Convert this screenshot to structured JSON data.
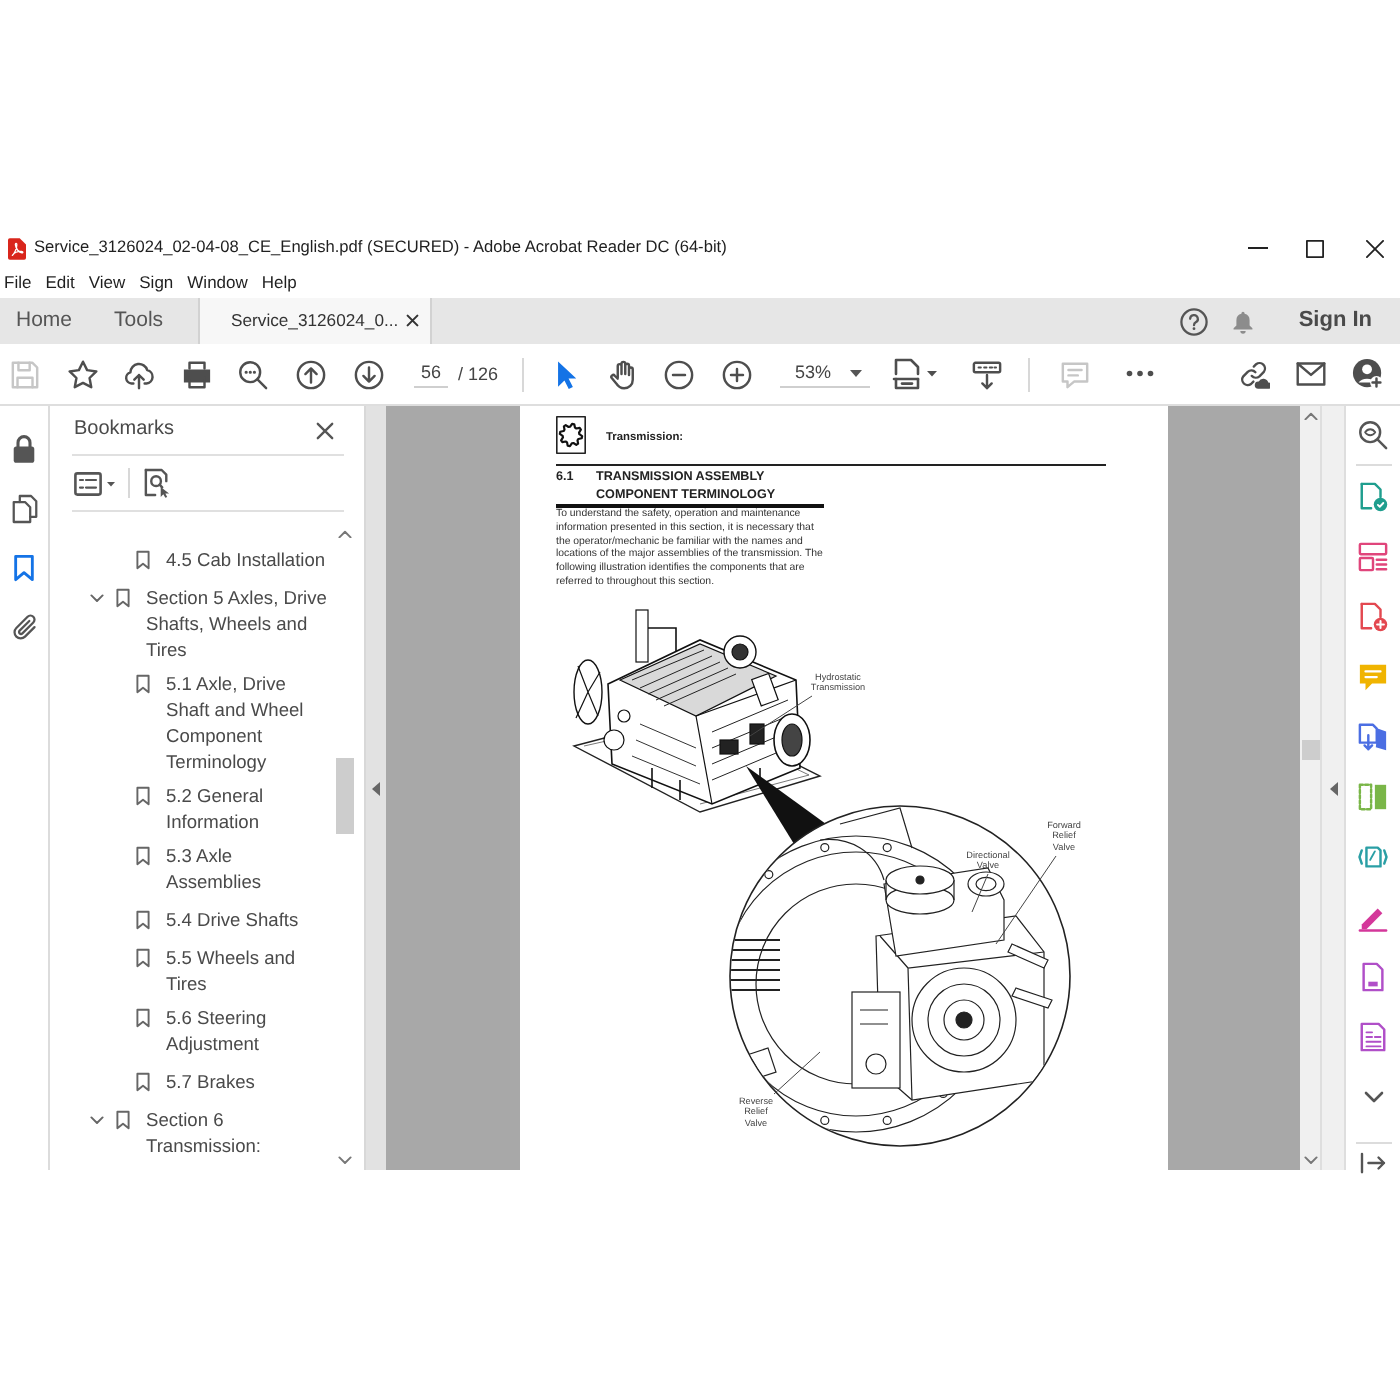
{
  "window": {
    "title": "Service_3126024_02-04-08_CE_English.pdf (SECURED) - Adobe Acrobat Reader DC (64-bit)"
  },
  "menu_bar": [
    "File",
    "Edit",
    "View",
    "Sign",
    "Window",
    "Help"
  ],
  "tabs": [
    {
      "label": "Home",
      "kind": "view",
      "selected": false
    },
    {
      "label": "Tools",
      "kind": "view",
      "selected": false
    },
    {
      "label": "Service_3126024_0...",
      "kind": "document",
      "selected": true
    }
  ],
  "tab_bar": {
    "sign_in": "Sign In"
  },
  "toolbar": {
    "file_tools": [
      {
        "kind": "save",
        "disabled": true
      },
      {
        "kind": "star",
        "disabled": false
      },
      {
        "kind": "upload",
        "disabled": false
      },
      {
        "kind": "print",
        "disabled": false
      },
      {
        "kind": "find",
        "disabled": false
      },
      {
        "kind": "previous-page",
        "disabled": false
      },
      {
        "kind": "next-page",
        "disabled": false
      }
    ],
    "page_number": "56",
    "page_total": "/ 126",
    "pointer_modes": [
      {
        "kind": "select",
        "selected": true
      },
      {
        "kind": "hand",
        "selected": false
      }
    ],
    "zoom_buttons": [
      {
        "kind": "zoom-out",
        "disabled": false
      },
      {
        "kind": "zoom-in",
        "disabled": false
      }
    ],
    "zoom_value": "53%",
    "view_tools": [
      {
        "kind": "fit-page",
        "disabled": false
      },
      {
        "kind": "scroll-mode",
        "disabled": false
      }
    ],
    "comment_tools": [
      {
        "kind": "comment",
        "disabled": true
      },
      {
        "kind": "more",
        "disabled": false
      }
    ],
    "account_tools": [
      {
        "kind": "share-link",
        "disabled": false
      },
      {
        "kind": "mail",
        "disabled": false
      },
      {
        "kind": "account",
        "disabled": false
      }
    ]
  },
  "side_rail": [
    {
      "kind": "lock",
      "selected": false
    },
    {
      "kind": "pages",
      "selected": false
    },
    {
      "kind": "bookmarks",
      "selected": true
    },
    {
      "kind": "attachments",
      "selected": false
    }
  ],
  "bookmarks_panel": {
    "title": "Bookmarks",
    "items": [
      {
        "children": [
          {
            "label": "4.5 Cab Installation",
            "selected": false
          }
        ]
      },
      {
        "label": "Section 5 Axles, Drive Shafts, Wheels and Tires",
        "expanded": true,
        "selected": false,
        "children": [
          {
            "label": "5.1 Axle, Drive Shaft and Wheel Component Terminology",
            "selected": false
          },
          {
            "label": "5.2 General Information",
            "selected": false
          },
          {
            "label": "5.3 Axle Assemblies",
            "selected": false
          },
          {
            "label": "5.4 Drive Shafts",
            "selected": false
          },
          {
            "label": "5.5 Wheels and Tires",
            "selected": false
          },
          {
            "label": "5.6 Steering Adjustment",
            "selected": false
          },
          {
            "label": "5.7 Brakes",
            "selected": false
          }
        ]
      },
      {
        "label": "Section 6 Transmission:",
        "expanded": true,
        "selected": false
      }
    ]
  },
  "document_page": {
    "section_header": "Transmission:",
    "section_number": "6.1",
    "section_title": "TRANSMISSION ASSEMBLY COMPONENT TERMINOLOGY",
    "paragraph": "To understand the safety, operation and maintenance information presented in this section, it is necessary that the operator/mechanic be familiar with the names and locations of the major assemblies of the transmission. The following illustration identifies the components that are referred to throughout this section.",
    "callouts": [
      "Hydrostatic Transmission",
      "Directional Valve",
      "Forward Relief Valve",
      "Reverse Relief Valve"
    ]
  }
}
